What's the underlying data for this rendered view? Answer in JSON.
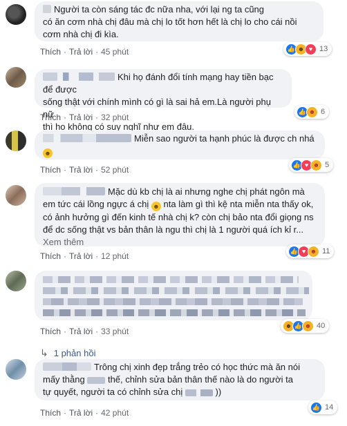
{
  "labels": {
    "like": "Thích",
    "reply": "Trả lời",
    "sep": "·"
  },
  "comments": [
    {
      "line1": "Người ta còn sáng tác đc nữa nha, với lại ng ta cũng",
      "line2": "có ăn cơm nhà chị đâu mà chị lo tốt hơn hết là chị lo cho cái nồi",
      "line3": "cơm nhà chị đi kìa.",
      "time": "45 phút",
      "reaction_count": "13"
    },
    {
      "line1": "Khi họ đánh đổi tính mạng hay tiền bạc để được",
      "line2": "sống thật với chính mình có gì là sai hả em.Là người phụ nữ",
      "line3": "thì họ không có suy nghĩ như em đâu.",
      "time": "32 phút",
      "reaction_count": "6"
    },
    {
      "line1": "Miễn sao người ta hạnh phúc là được ch nhá",
      "time": "52 phút",
      "reaction_count": "5"
    },
    {
      "line1": "Mặc dù kb chị là ai nhưng nghe chị phát ngôn mà",
      "line2a": "em tức cái lồng ngực á chị",
      "line2b": "nta làm gì thì kệ nta miễn nta thấy ok,",
      "line3": "có ảnh hưởng gì đến kinh tế nhà chị k? còn chị bảo nta đổi giọng ns",
      "line4": "để dc sống thật vs bản thân là ngu thì chị là 1 người quá ích kỉ r...",
      "see_more": "Xem thêm",
      "time": "12 phút",
      "reaction_count": "11"
    },
    {
      "time": "33 phút",
      "reaction_count": "40",
      "replies": "1 phản hồi"
    },
    {
      "line1": "Trông chị xinh đẹp trắng trẻo có học thức mà ăn nói",
      "line2a": "mấy thằng",
      "line2b": "thế, chỉnh sửa bản thân thế nào là do người ta",
      "line3a": "tự quyết, người ta có chỉnh sửa chị",
      "line3b": "))",
      "time": "42 phút",
      "reaction_count": "14"
    }
  ],
  "colors": {
    "bubble": "#f0f2f5",
    "link_blue": "#385898",
    "meta_gray": "#65676b",
    "like_blue": "#1877f2"
  }
}
